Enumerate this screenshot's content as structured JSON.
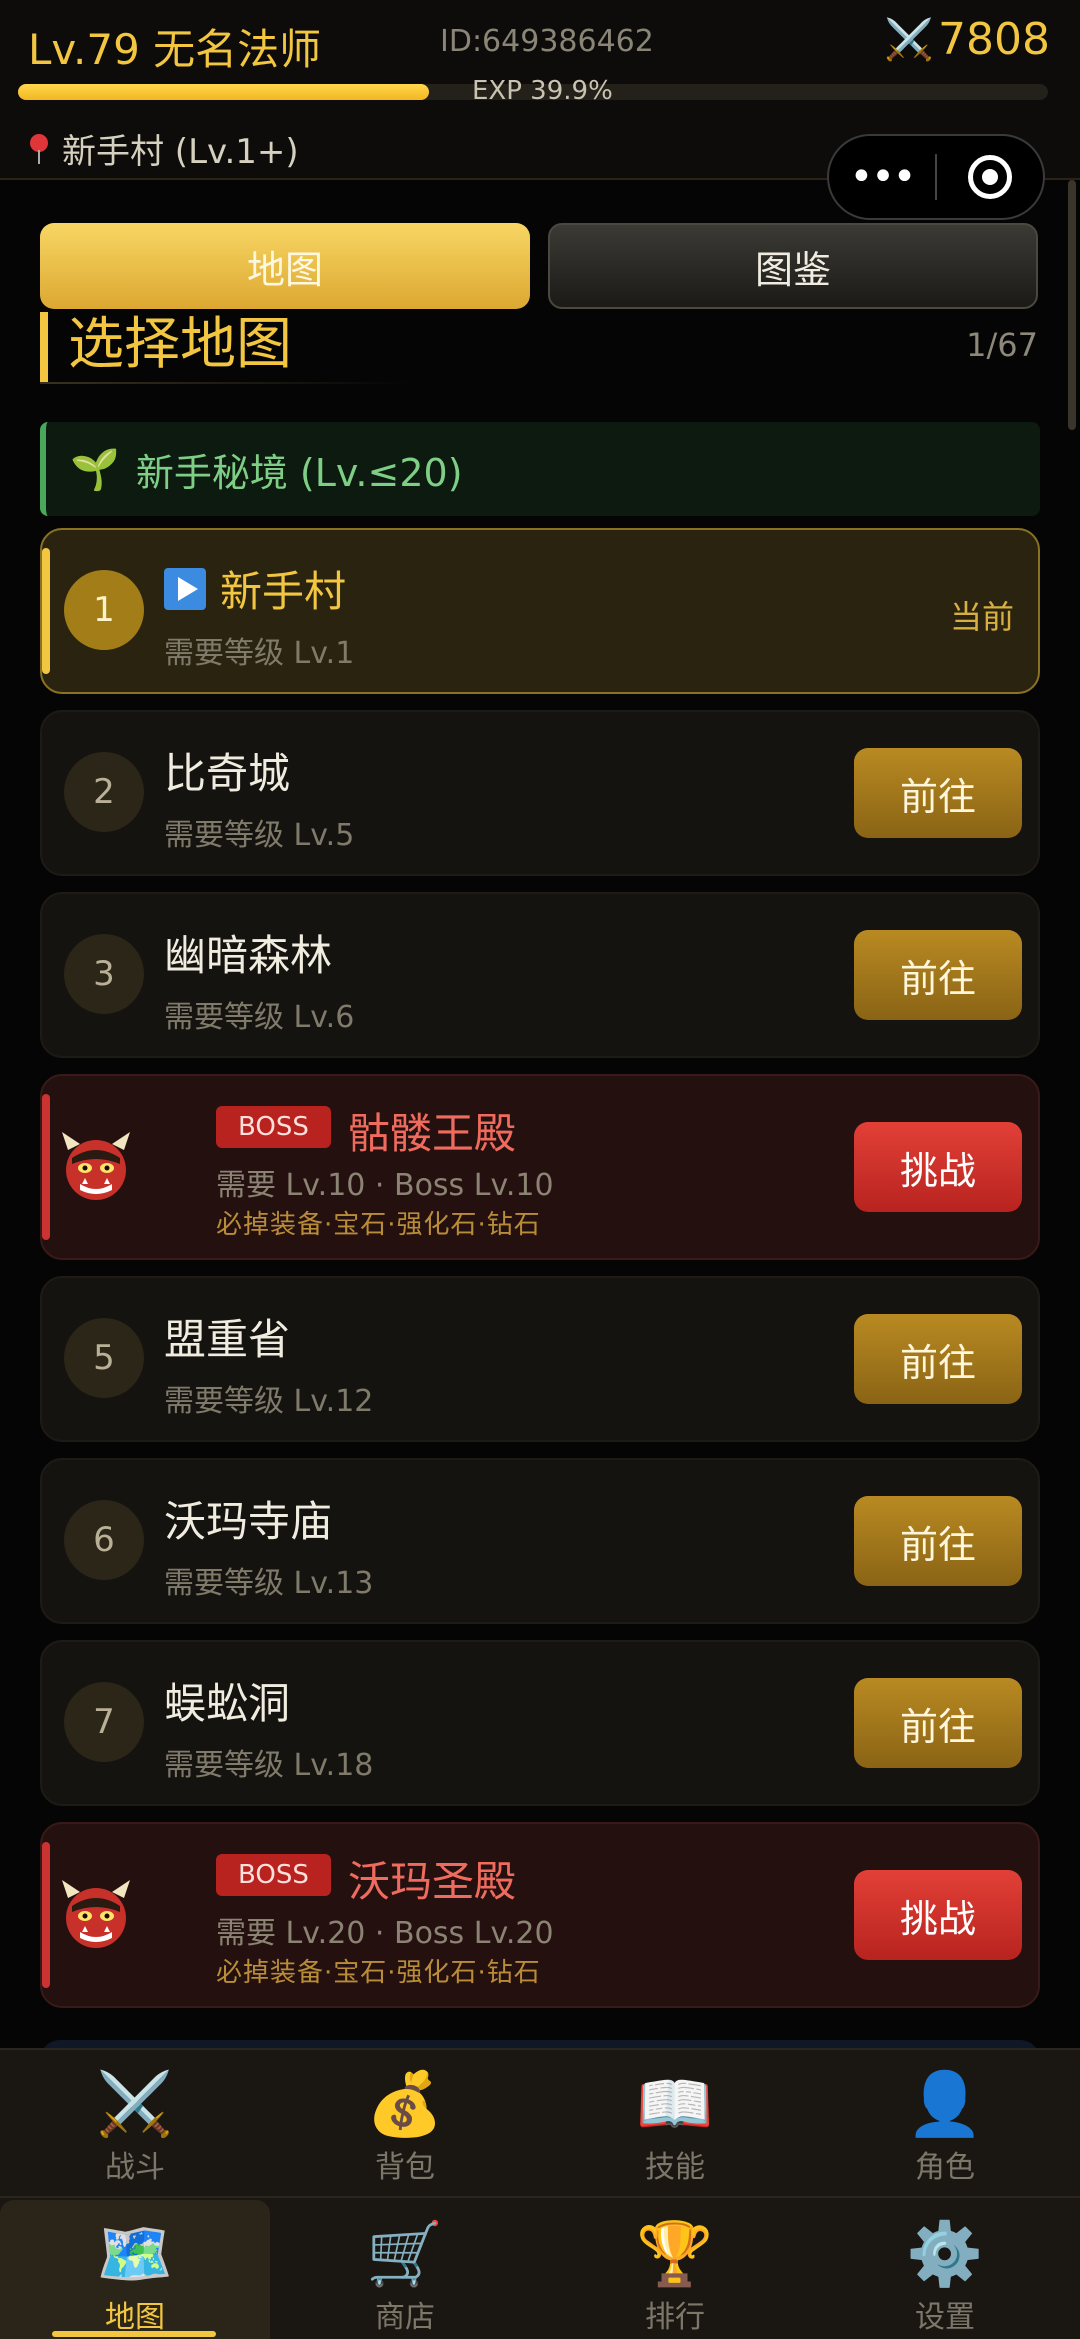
{
  "header": {
    "level_title": "Lv.79 无名法师",
    "player_id": "ID:649386462",
    "power_icon": "crossed-swords-icon",
    "power_value": "7808",
    "exp_fraction": 0.399,
    "exp_text": "EXP 39.9%",
    "location": "新手村 (Lv.1+)"
  },
  "tabs": {
    "map": "地图",
    "codex": "图鉴"
  },
  "section": {
    "title": "选择地图",
    "page_count": "1/67"
  },
  "category": {
    "label": "新手秘境 (Lv.≤20)"
  },
  "maps": [
    {
      "num": "1",
      "name": "新手村",
      "req": "需要等级 Lv.1",
      "state": "当前"
    },
    {
      "num": "2",
      "name": "比奇城",
      "req": "需要等级 Lv.5",
      "action": "前往"
    },
    {
      "num": "3",
      "name": "幽暗森林",
      "req": "需要等级 Lv.6",
      "action": "前往"
    },
    {
      "badge": "BOSS",
      "name": "骷髅王殿",
      "req": "需要 Lv.10 · Boss Lv.10",
      "drops": "必掉装备·宝石·强化石·钻石",
      "action": "挑战"
    },
    {
      "num": "5",
      "name": "盟重省",
      "req": "需要等级 Lv.12",
      "action": "前往"
    },
    {
      "num": "6",
      "name": "沃玛寺庙",
      "req": "需要等级 Lv.13",
      "action": "前往"
    },
    {
      "num": "7",
      "name": "蜈蚣洞",
      "req": "需要等级 Lv.18",
      "action": "前往"
    },
    {
      "badge": "BOSS",
      "name": "沃玛圣殿",
      "req": "需要 Lv.20 · Boss Lv.20",
      "drops": "必掉装备·宝石·强化石·钻石",
      "action": "挑战"
    }
  ],
  "nav": [
    {
      "label": "战斗",
      "icon": "crossed-swords-icon"
    },
    {
      "label": "背包",
      "icon": "money-bag-icon"
    },
    {
      "label": "技能",
      "icon": "book-icon"
    },
    {
      "label": "角色",
      "icon": "person-icon"
    },
    {
      "label": "地图",
      "icon": "world-map-icon",
      "active": true
    },
    {
      "label": "商店",
      "icon": "shopping-cart-icon"
    },
    {
      "label": "排行",
      "icon": "trophy-icon"
    },
    {
      "label": "设置",
      "icon": "gear-icon"
    }
  ]
}
